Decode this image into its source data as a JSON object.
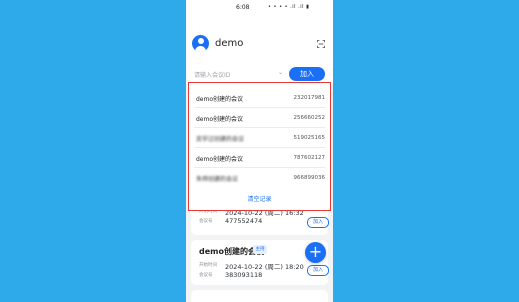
{
  "status_bar": {
    "time": "6:08",
    "icons_text": "• • • • .il .il ▮"
  },
  "header": {
    "username": "demo"
  },
  "search": {
    "placeholder": "请输入会议ID",
    "join_label": "加入"
  },
  "history": {
    "items": [
      {
        "name": "demo创建的会议",
        "id": "232017981",
        "blurred": false
      },
      {
        "name": "demo创建的会议",
        "id": "256660252",
        "blurred": false
      },
      {
        "name": "吴宇过创建的会议",
        "id": "519025165",
        "blurred": true
      },
      {
        "name": "demo创建的会议",
        "id": "787602127",
        "blurred": false
      },
      {
        "name": "朱帅创建的会议",
        "id": "966899036",
        "blurred": true
      }
    ],
    "clear_label": "清空记录"
  },
  "meetings": [
    {
      "time_label": "开始时间",
      "time": "2024-10-22 (周二) 16:32",
      "id_label": "会议号",
      "id": "477552474",
      "join_label": "加入"
    },
    {
      "title": "demo创建的会议",
      "badge": "主持",
      "time_label": "开始时间",
      "time": "2024-10-22 (周二) 18:20",
      "id_label": "会议号",
      "id": "383093118",
      "join_label": "加入"
    }
  ],
  "fab": {
    "label": "+"
  },
  "colors": {
    "accent": "#1b6ff5",
    "background": "#2eaaea",
    "highlight_border": "#e53935"
  }
}
